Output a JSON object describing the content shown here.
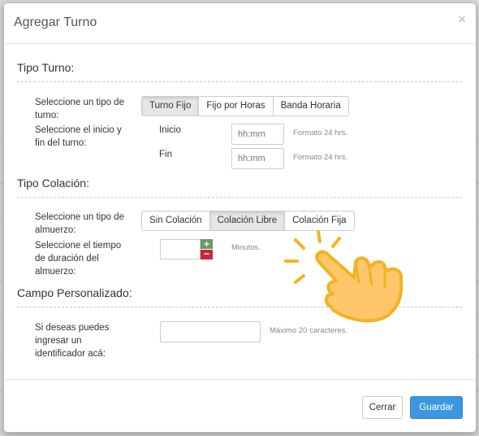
{
  "modal": {
    "title": "Agregar Turno",
    "close_glyph": "×"
  },
  "tipo_turno": {
    "heading": "Tipo Turno:",
    "type_label": "Seleccione un tipo de turno:",
    "type_options": [
      "Turno Fijo",
      "Fijo por Horas",
      "Banda Horaria"
    ],
    "type_selected": "Turno Fijo",
    "range_label": "Seleccione el inicio y fin del turno:",
    "start_label": "Inicio",
    "start_placeholder": "hh:mm",
    "end_label": "Fin",
    "end_placeholder": "hh:mm",
    "format_hint": "Formato 24 hrs."
  },
  "tipo_colacion": {
    "heading": "Tipo Colación:",
    "type_label": "Seleccione un tipo de almuerzo:",
    "type_options": [
      "Sin Colación",
      "Colación Libre",
      "Colación Fija"
    ],
    "type_selected": "Colación Libre",
    "duration_label": "Seleccione el tiempo de duración del almuerzo:",
    "duration_unit": "Minutos.",
    "plus_glyph": "+",
    "minus_glyph": "−"
  },
  "campo_personalizado": {
    "heading": "Campo Personalizado:",
    "label": "Si deseas puedes ingresar un identificador acá:",
    "hint": "Máximo 20 caracteres."
  },
  "footer": {
    "cancel_label": "Cerrar",
    "save_label": "Guardar"
  },
  "colors": {
    "primary": "#3d97e0",
    "plus": "#6a9963",
    "minus": "#c9253f",
    "hand_fill": "#fdc76a",
    "hand_outline": "#f2b320"
  },
  "overlay_icon": "pointing-hand-icon"
}
